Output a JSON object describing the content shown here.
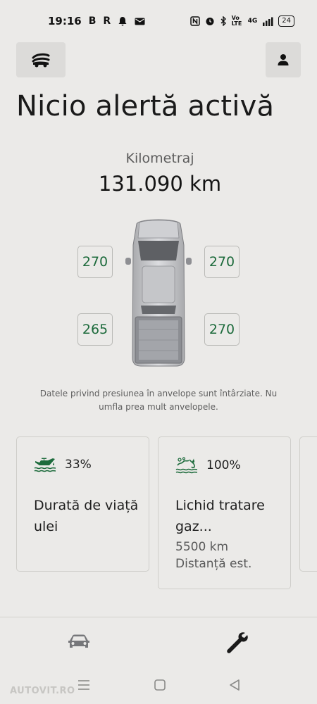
{
  "status_bar": {
    "time": "19:16",
    "left_glyphs": [
      "B",
      "R"
    ],
    "network": "4G",
    "volte": "Vo LTE",
    "battery": "24"
  },
  "header": {
    "title": "Nicio alertă activă"
  },
  "odometer": {
    "label": "Kilometraj",
    "value": "131.090 km"
  },
  "tires": {
    "front_left": "270",
    "front_right": "270",
    "rear_left": "265",
    "rear_right": "270"
  },
  "tire_note": "Datele privind presiunea în anvelope sunt întârziate. Nu umfla prea mult anvelopele.",
  "cards": [
    {
      "percent": "33%",
      "title": "Durată de viață ulei"
    },
    {
      "percent": "100%",
      "title": "Lichid tratare gaz...",
      "distance": "5500 km",
      "distance_label": "Distanță est."
    }
  ],
  "colors": {
    "background": "#ebeae8",
    "accent_green": "#1d6b3c",
    "icon_dark": "#1e1e1e"
  },
  "icons": {
    "menu": "vehicle-menu-icon",
    "profile": "person-icon",
    "oil": "oil-can-icon",
    "fluid": "exhaust-fluid-icon",
    "nav_vehicle": "car-icon",
    "nav_service": "wrench-icon"
  },
  "watermark": "AUTOVIT.RO"
}
